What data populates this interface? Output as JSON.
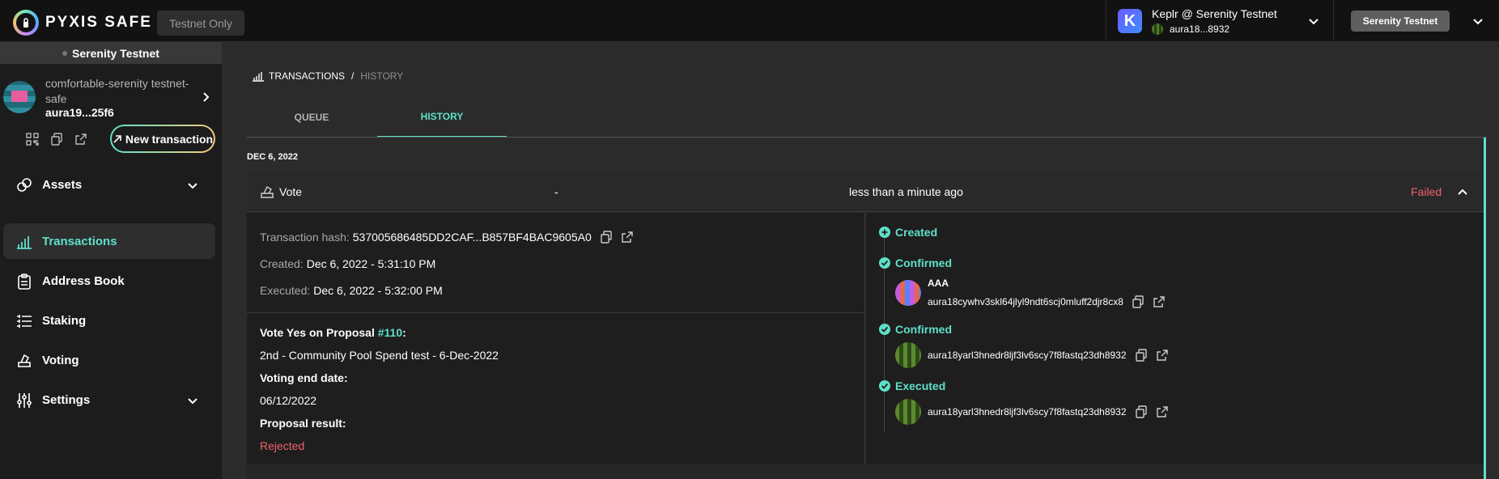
{
  "header": {
    "logo_text": "PYXIS SAFE",
    "testnet_chip": "Testnet Only",
    "wallet_name": "Keplr @ Serenity Testnet",
    "wallet_addr": "aura18...8932",
    "wallet_letter": "K",
    "network_chip": "Serenity Testnet"
  },
  "sidebar": {
    "network": "Serenity Testnet",
    "safe_name": "comfortable-serenity testnet-safe",
    "safe_addr": "aura19...25f6",
    "new_tx_label": "New transaction",
    "items": [
      {
        "label": "Assets"
      },
      {
        "label": "Transactions"
      },
      {
        "label": "Address Book"
      },
      {
        "label": "Staking"
      },
      {
        "label": "Voting"
      },
      {
        "label": "Settings"
      }
    ]
  },
  "breadcrumb": {
    "section": "TRANSACTIONS",
    "separator": "/",
    "current": "HISTORY"
  },
  "tabs": {
    "queue": "QUEUE",
    "history": "HISTORY"
  },
  "date_label": "DEC 6, 2022",
  "transaction": {
    "type": "Vote",
    "dash": "-",
    "time": "less than a minute ago",
    "status": "Failed",
    "hash_label": "Transaction hash:",
    "hash": "537005686485DD2CAF...B857BF4BAC9605A0",
    "created_label": "Created:",
    "created": "Dec 6, 2022 - 5:31:10 PM",
    "executed_label": "Executed:",
    "executed": "Dec 6, 2022 - 5:32:00 PM",
    "vote_prefix": "Vote Yes on Proposal ",
    "proposal_link": "#110",
    "colon": ":",
    "proposal_title": "2nd - Community Pool Spend test - 6-Dec-2022",
    "end_date_label": "Voting end date:",
    "end_date": "06/12/2022",
    "result_label": "Proposal result:",
    "result": "Rejected"
  },
  "timeline": {
    "created": "Created",
    "confirmed_1": "Confirmed",
    "owner_1_name": "AAA",
    "owner_1_addr": "aura18cywhv3skl64jlyl9ndt6scj0mluff2djr8cx8",
    "confirmed_2": "Confirmed",
    "owner_2_addr": "aura18yarl3hnedr8ljf3lv6scy7f8fastq23dh8932",
    "executed": "Executed",
    "owner_3_addr": "aura18yarl3hnedr8ljf3lv6scy7f8fastq23dh8932"
  },
  "colors": {
    "accent": "#5ee0c8",
    "failed": "#f0616a",
    "background": "#2b2b2b",
    "sidebar": "#1c1c1c"
  }
}
